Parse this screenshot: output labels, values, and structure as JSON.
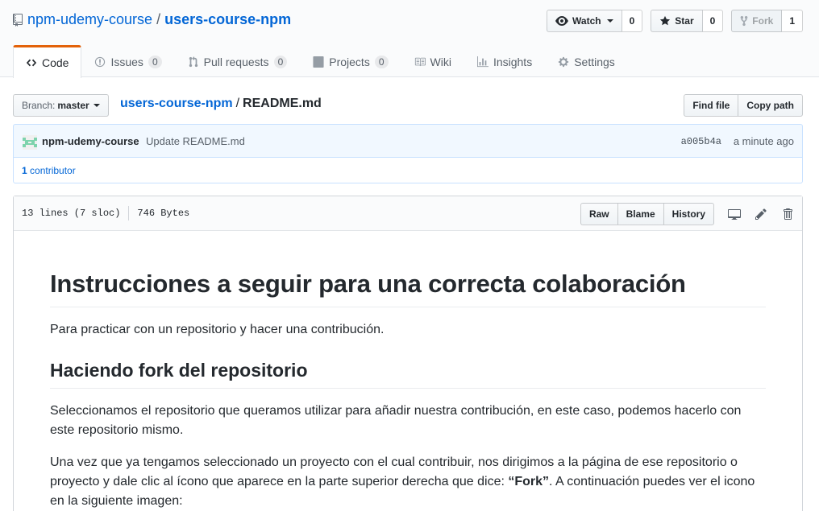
{
  "repo": {
    "owner": "npm-udemy-course",
    "separator": "/",
    "name": "users-course-npm"
  },
  "actions": {
    "watch_label": "Watch",
    "watch_count": "0",
    "star_label": "Star",
    "star_count": "0",
    "fork_label": "Fork",
    "fork_count": "1"
  },
  "nav": {
    "code": "Code",
    "issues": "Issues",
    "issues_count": "0",
    "pulls": "Pull requests",
    "pulls_count": "0",
    "projects": "Projects",
    "projects_count": "0",
    "wiki": "Wiki",
    "insights": "Insights",
    "settings": "Settings"
  },
  "file_nav": {
    "branch_label": "Branch:",
    "branch_value": "master",
    "crumb_repo": "users-course-npm",
    "crumb_sep": "/",
    "crumb_file": "README.md",
    "find_file": "Find file",
    "copy_path": "Copy path"
  },
  "commit": {
    "author": "npm-udemy-course",
    "message": "Update README.md",
    "sha": "a005b4a",
    "time": "a minute ago",
    "contributors_count": "1",
    "contributors_label": "contributor"
  },
  "file": {
    "lines": "13 lines (7 sloc)",
    "size": "746 Bytes",
    "raw": "Raw",
    "blame": "Blame",
    "history": "History"
  },
  "readme": {
    "h1": "Instrucciones a seguir para una correcta colaboración",
    "p1": "Para practicar con un repositorio y hacer una contribución.",
    "h2": "Haciendo fork del repositorio",
    "p2": "Seleccionamos el repositorio que queramos utilizar para añadir nuestra contribución, en este caso, podemos hacerlo con este repositorio mismo.",
    "p3_a": "Una vez que ya tengamos seleccionado un proyecto con el cual contribuir, nos dirigimos a la página de ese repositorio o proyecto y dale clic al ícono que aparece en la parte superior derecha que dice: ",
    "p3_strong": "“Fork”",
    "p3_b": ". A continuación puedes ver el icono en la siguiente imagen:"
  }
}
